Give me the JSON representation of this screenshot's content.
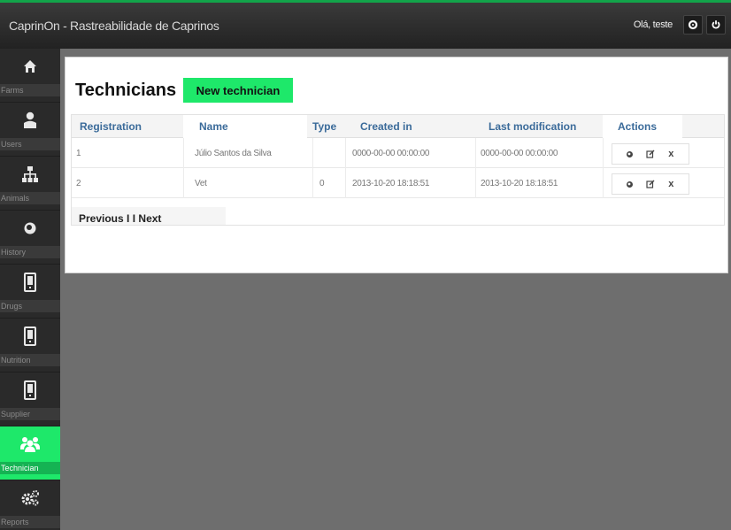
{
  "app": {
    "title": "CaprinOn - Rastreabilidade de Caprinos",
    "greeting": "Olá, teste"
  },
  "colors": {
    "accent": "#1ee86a",
    "header_text": "#3b6b9a"
  },
  "sidebar": {
    "items": [
      {
        "label": "Farms",
        "icon": "home-icon"
      },
      {
        "label": "Users",
        "icon": "user-icon"
      },
      {
        "label": "Animals",
        "icon": "sitemap-icon"
      },
      {
        "label": "History",
        "icon": "eye-icon"
      },
      {
        "label": "Drugs",
        "icon": "device-icon"
      },
      {
        "label": "Nutrition",
        "icon": "device-icon"
      },
      {
        "label": "Supplier",
        "icon": "device-icon"
      },
      {
        "label": "Technician",
        "icon": "group-icon",
        "active": true
      },
      {
        "label": "Reports",
        "icon": "cogs-icon"
      }
    ]
  },
  "main": {
    "title": "Technicians",
    "new_button": "New technician",
    "table": {
      "headers": [
        "Registration",
        "Name",
        "Type",
        "Created in",
        "Last modification",
        "Actions"
      ],
      "rows": [
        {
          "registration": "1",
          "name": "Júlio Santos da Silva",
          "type": "",
          "created": "0000-00-00 00:00:00",
          "modified": "0000-00-00 00:00:00"
        },
        {
          "registration": "2",
          "name": "Vet",
          "type": "0",
          "created": "2013-10-20 18:18:51",
          "modified": "2013-10-20 18:18:51"
        }
      ],
      "action_icons": [
        "view-icon",
        "edit-icon",
        "delete-icon"
      ],
      "delete_glyph": "x"
    },
    "pager": {
      "previous": "Previous",
      "sep": "I I",
      "next": "Next"
    }
  }
}
